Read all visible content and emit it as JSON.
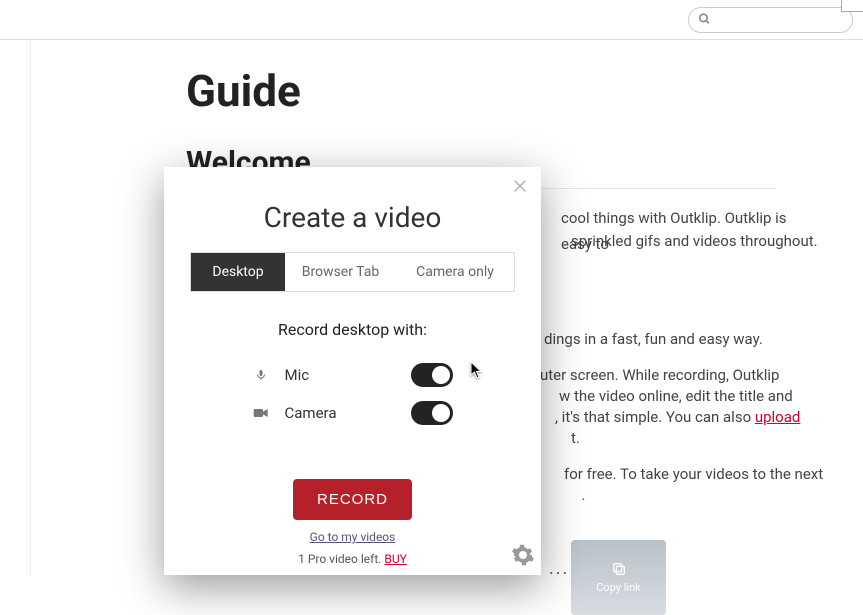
{
  "search": {
    "placeholder": ""
  },
  "page": {
    "title": "Guide",
    "heading": "Welcome",
    "para1_tail": " cool things with Outklip. Outklip is easy to",
    "para2_tail": " sprinkled gifs and videos throughout.",
    "para3_tail": "dings in a fast, fun and easy way.",
    "para4_tail": "uter screen. While recording, Outklip",
    "para5_tail": "w the video online, edit the title and",
    "para6_tail": ", it's that simple. You can also ",
    "upload_link": "upload",
    "para7_tail": "t.",
    "para8_tail": " for free. To take your videos to the next",
    "period": ".",
    "thumb_copy": "Copy link",
    "dots": "..."
  },
  "modal": {
    "title": "Create a video",
    "tabs": {
      "desktop": "Desktop",
      "browser": "Browser Tab",
      "camera": "Camera only"
    },
    "rec_instruction": "Record desktop with:",
    "toggles": {
      "mic": "Mic",
      "camera": "Camera"
    },
    "record_btn": "RECORD",
    "go_to_videos": "Go to my videos",
    "pro_prefix": "1 Pro video left. ",
    "buy": "BUY"
  }
}
